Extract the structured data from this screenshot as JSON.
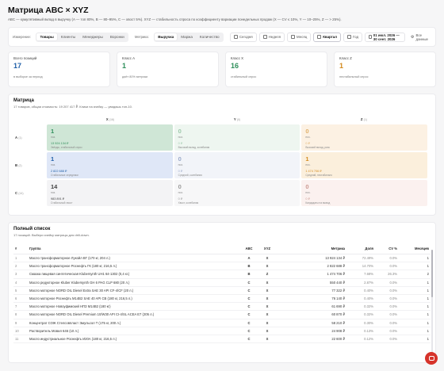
{
  "header": {
    "title": "Матрица ABC × XYZ",
    "subtitle": "ABC — кумулятивный вклад в выручку (A — топ 80%, B — 80–95%, C — хвост 5%). XYZ — стабильность спроса по коэффициенту вариации понедельных продаж (X — CV ≤ 10%, Y — 10–25%, Z — > 25%)."
  },
  "toolbar": {
    "dimension_label": "Измерение:",
    "dimensions": [
      "Товары",
      "Клиенты",
      "Менеджеры",
      "Воронки"
    ],
    "metric_label": "Метрика:",
    "metrics": [
      "Выручка",
      "Маржа",
      "Количество"
    ],
    "periods": [
      "Сегодня",
      "Неделя",
      "Месяц",
      "Квартал",
      "Год"
    ],
    "date_range": "01 июл. 2026 — 30 сент. 2026",
    "all_data": "Все данные"
  },
  "stats": [
    {
      "label": "Всего позиций",
      "value": "17",
      "hint": "в выборке за период",
      "color": "#1f5fa8"
    },
    {
      "label": "Класс A",
      "value": "1",
      "hint": "даёт 80% метрики",
      "color": "#2f8f5b"
    },
    {
      "label": "Класс X",
      "value": "16",
      "hint": "стабильный спрос",
      "color": "#2f8f5b"
    },
    {
      "label": "Класс Z",
      "value": "1",
      "hint": "нестабильный спрос",
      "color": "#d38a1e"
    }
  ],
  "matrix": {
    "title": "Матрица",
    "subtitle": "17 товаров, общая стоимость: 19 207 417 ₽. Клики на ячейку — увидишь топ-10.",
    "columns": [
      {
        "label": "X",
        "hint": "(16)"
      },
      {
        "label": "Y",
        "hint": "(0)"
      },
      {
        "label": "Z",
        "hint": "(1)"
      }
    ],
    "rows": [
      {
        "label": "A",
        "hint": "(1)"
      },
      {
        "label": "B",
        "hint": "(2)"
      },
      {
        "label": "C",
        "hint": "(14)"
      }
    ],
    "cells": [
      {
        "count": "1",
        "pos": "поз.",
        "revenue": "13 924 134 ₽",
        "note": "Звёзды, стабильный спрос",
        "bg": "#cfe6d6",
        "fg": "#2f8f5b"
      },
      {
        "count": "0",
        "pos": "поз.",
        "revenue": "0 ₽",
        "note": "Высокий вклад, колебания",
        "bg": "#eef6f0",
        "fg": "#9cc8aa"
      },
      {
        "count": "0",
        "pos": "поз.",
        "revenue": "0 ₽",
        "note": "Высокий вклад, риск",
        "bg": "#fcf1e3",
        "fg": "#e0b06a"
      },
      {
        "count": "1",
        "pos": "поз.",
        "revenue": "2 822 688 ₽",
        "note": "Стабильные середняки",
        "bg": "#dfe7f7",
        "fg": "#1f5fa8"
      },
      {
        "count": "0",
        "pos": "поз.",
        "revenue": "0 ₽",
        "note": "Средний, колебания",
        "bg": "#f2f4f9",
        "fg": "#9aa9c9"
      },
      {
        "count": "1",
        "pos": "поз.",
        "revenue": "1 474 706 ₽",
        "note": "Средний, нестабильно",
        "bg": "#fbefdc",
        "fg": "#d38a1e"
      },
      {
        "count": "14",
        "pos": "поз.",
        "revenue": "983 891 ₽",
        "note": "Стабильный хвост",
        "bg": "#f3f3f5",
        "fg": "#444444"
      },
      {
        "count": "0",
        "pos": "поз.",
        "revenue": "0 ₽",
        "note": "Хвост, колебания",
        "bg": "#f7f7f8",
        "fg": "#999999"
      },
      {
        "count": "0",
        "pos": "поз.",
        "revenue": "0 ₽",
        "note": "Кандидаты на вывод",
        "bg": "#fbf1ef",
        "fg": "#cc9a92"
      }
    ]
  },
  "list": {
    "title": "Полный список",
    "subtitle": "17 позиций. Выбери ячейку матрицы для drill-down.",
    "headers": [
      "#",
      "Группа",
      "ABC",
      "XYZ",
      "Метрика",
      "Доля",
      "CV %",
      "Месяцев"
    ],
    "rows": [
      [
        "1",
        "Масло трансформаторное Лукойл ВГ (170 кг, 204 л.)",
        "A",
        "X",
        "13 924 134 ₽",
        "72.49%",
        "0.0%",
        "1"
      ],
      [
        "2",
        "Масло трансформаторное Роснефть ГК (180 кг, 216,5 л.)",
        "B",
        "X",
        "2 822 688 ₽",
        "14.70%",
        "0.0%",
        "1"
      ],
      [
        "3",
        "Смазка пищевая синтетическая Klubersynth UH1 64-1302 (0,4 кг.)",
        "B",
        "Z",
        "1 474 706 ₽",
        "7.68%",
        "26.3%",
        "2"
      ],
      [
        "4",
        "Масло редукторное Kluber Klubersynth GH 6 PAG CLP 680 (20 л.)",
        "C",
        "X",
        "550 440 ₽",
        "2.87%",
        "0.0%",
        "1"
      ],
      [
        "5",
        "Масло моторное NORD OIL Diesel Extra SAE 30 API CF-4/CF (20 л.)",
        "C",
        "X",
        "77 322 ₽",
        "0.40%",
        "0.0%",
        "1"
      ],
      [
        "6",
        "Масло моторное Роснефть М14В2 SAE 40 API CB (180 кг, 216,5 л.)",
        "C",
        "X",
        "76 140 ₽",
        "0.40%",
        "0.0%",
        "1"
      ],
      [
        "7",
        "Масло моторное Новоуфимский НПЗ М14В2 (180 кг)",
        "C",
        "X",
        "61 690 ₽",
        "0.32%",
        "0.0%",
        "1"
      ],
      [
        "8",
        "Масло моторное NORD OIL Diesel Premium 10/W30 API CI-4/SL ACEA E7 (205 л.)",
        "C",
        "X",
        "60 870 ₽",
        "0.32%",
        "0.0%",
        "1"
      ],
      [
        "9",
        "Концентрат СОЖ Стелсовпласт Эмульсол Т (175 кг, 200 л.)",
        "C",
        "X",
        "58 210 ₽",
        "0.30%",
        "0.0%",
        "1"
      ],
      [
        "10",
        "Растворитель Мовил 646 (10 л.)",
        "C",
        "X",
        "24 908 ₽",
        "0.13%",
        "0.0%",
        "1"
      ],
      [
        "11",
        "Масло индустриальное Роснефть И20А (180 кг, 216,5 л.)",
        "C",
        "X",
        "22 600 ₽",
        "0.12%",
        "0.0%",
        "1"
      ]
    ]
  },
  "colors": {
    "accent": "#1f5fa8",
    "fab": "#d6332a"
  },
  "icons": {
    "calendar": "calendar-icon",
    "settings": "sliders-icon",
    "chat": "chat-icon"
  }
}
